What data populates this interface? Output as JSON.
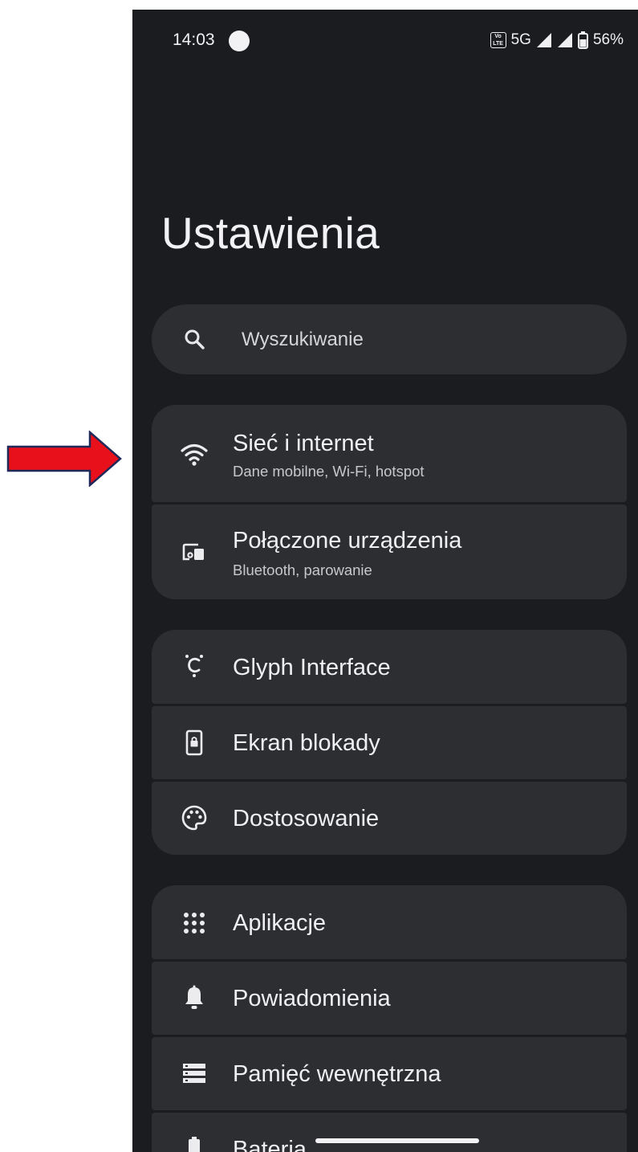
{
  "status_bar": {
    "time": "14:03",
    "network": "5G",
    "battery": "56%",
    "volte_icon": "volte-icon"
  },
  "page": {
    "title": "Ustawienia"
  },
  "search": {
    "placeholder": "Wyszukiwanie",
    "icon": "search-icon"
  },
  "groups": [
    {
      "items": [
        {
          "label": "Sieć i internet",
          "subtitle": "Dane mobilne, Wi-Fi, hotspot",
          "icon": "wifi-icon"
        },
        {
          "label": "Połączone urządzenia",
          "subtitle": "Bluetooth, parowanie",
          "icon": "connected-devices-icon"
        }
      ]
    },
    {
      "items": [
        {
          "label": "Glyph Interface",
          "icon": "glyph-icon"
        },
        {
          "label": "Ekran blokady",
          "icon": "lock-screen-icon"
        },
        {
          "label": "Dostosowanie",
          "icon": "palette-icon"
        }
      ]
    },
    {
      "items": [
        {
          "label": "Aplikacje",
          "icon": "apps-grid-icon"
        },
        {
          "label": "Powiadomienia",
          "icon": "bell-icon"
        },
        {
          "label": "Pamięć wewnętrzna",
          "icon": "storage-icon"
        },
        {
          "label": "Bateria",
          "icon": "battery-icon"
        }
      ]
    }
  ],
  "colors": {
    "background": "#1b1c1f",
    "card": "#2d2e32",
    "text": "#f0f0f2",
    "annotation_arrow": "#e8101a"
  },
  "annotation": {
    "icon": "red-arrow-icon"
  }
}
